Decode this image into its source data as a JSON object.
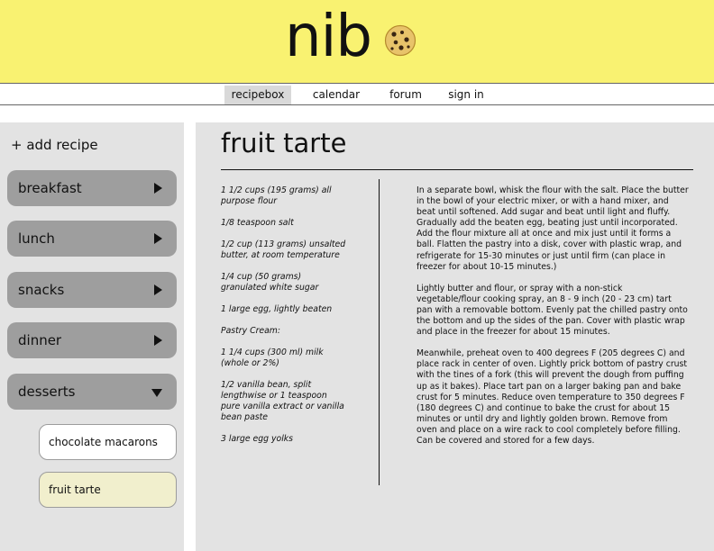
{
  "header": {
    "logo": "nib",
    "logo_icon": "cookie-icon",
    "background": "#f9f271"
  },
  "nav": {
    "items": [
      {
        "label": "recipebox",
        "active": true
      },
      {
        "label": "calendar",
        "active": false
      },
      {
        "label": "forum",
        "active": false
      },
      {
        "label": "sign in",
        "active": false
      }
    ]
  },
  "sidebar": {
    "add_recipe": "+ add recipe",
    "categories": [
      {
        "label": "breakfast",
        "expanded": false
      },
      {
        "label": "lunch",
        "expanded": false
      },
      {
        "label": "snacks",
        "expanded": false
      },
      {
        "label": "dinner",
        "expanded": false
      },
      {
        "label": "desserts",
        "expanded": true
      }
    ],
    "dessert_items": [
      {
        "label": "chocolate macarons",
        "selected": false
      },
      {
        "label": "fruit tarte",
        "selected": true
      }
    ],
    "selected_color": "#f1efcd"
  },
  "recipe": {
    "title": "fruit tarte",
    "ingredients": [
      "1 1/2 cups (195 grams) all purpose flour",
      "1/8 teaspoon salt",
      "1/2 cup (113 grams) unsalted butter, at room temperature",
      "1/4 cup (50 grams) granulated white sugar",
      "1 large egg, lightly beaten",
      "Pastry Cream:",
      "1 1/4 cups (300 ml) milk (whole or 2%)",
      "1/2 vanilla bean, split lengthwise or 1 teaspoon pure vanilla extract or vanilla bean paste",
      "3 large egg yolks"
    ],
    "steps": [
      "In a separate bowl, whisk the flour with the salt. Place the butter in the bowl of your electric mixer, or with a hand mixer, and beat until softened. Add sugar and beat until light and fluffy. Gradually add the beaten egg, beating just until incorporated. Add the flour mixture all at once and mix just until it forms a ball. Flatten the pastry into a disk, cover with plastic wrap, and refrigerate for 15-30 minutes or just until firm (can place in freezer for about 10-15 minutes.)",
      "Lightly butter and flour, or spray with a non-stick vegetable/flour cooking spray, an 8 - 9 inch (20 - 23 cm) tart pan with a removable bottom. Evenly pat the chilled pastry onto the bottom and up the sides of the pan. Cover with plastic wrap and place in the freezer for about 15 minutes.",
      "Meanwhile, preheat oven to 400 degrees F (205 degrees C) and place rack in center of oven. Lightly prick bottom of pastry crust with the tines of a fork (this will prevent the dough from puffing up as it bakes). Place tart pan on a larger baking pan and bake crust for 5 minutes. Reduce oven temperature to 350 degrees F (180 degrees C) and continue to bake the crust for about 15 minutes or until dry and lightly golden brown. Remove from oven and place on a wire rack to cool completely before filling. Can be covered and stored for a few days."
    ]
  }
}
